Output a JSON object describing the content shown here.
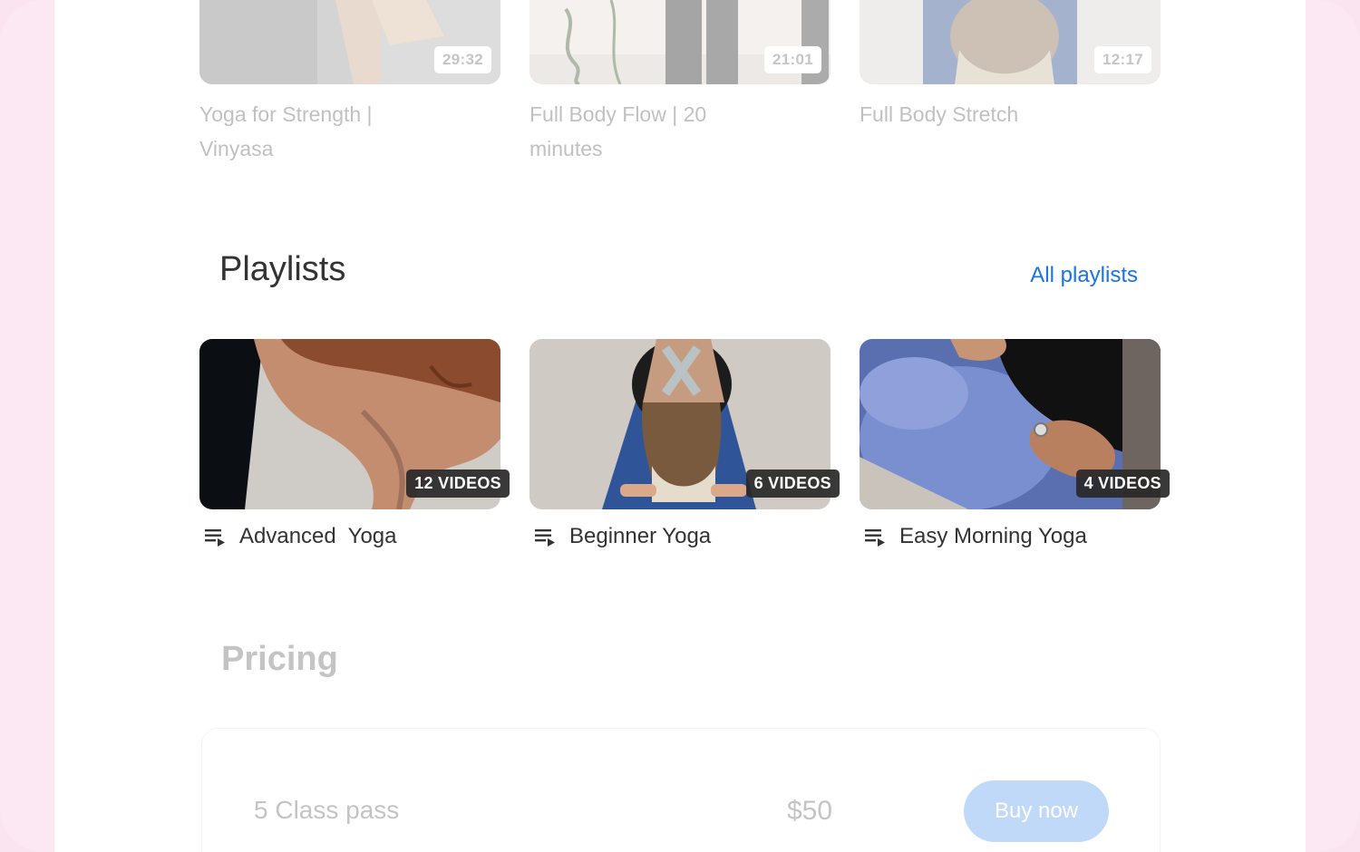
{
  "videos": [
    {
      "title": "Yoga for Strength | Vinyasa",
      "duration": "29:32"
    },
    {
      "title": "Full Body Flow | 20 minutes",
      "duration": "21:01"
    },
    {
      "title": "Full Body Stretch",
      "duration": "12:17"
    }
  ],
  "playlists_section": {
    "title": "Playlists",
    "all_link": "All playlists",
    "items": [
      {
        "title": "Advanced  Yoga",
        "count": "12 VIDEOS"
      },
      {
        "title": "Beginner Yoga",
        "count": "6 VIDEOS"
      },
      {
        "title": "Easy Morning Yoga",
        "count": "4 VIDEOS"
      }
    ]
  },
  "pricing": {
    "title": "Pricing",
    "plans": [
      {
        "name": "5 Class pass",
        "price": "$50",
        "button": "Buy now"
      }
    ]
  },
  "colors": {
    "link": "#1a73e8",
    "button": "#5b9cf0",
    "frame": "#fce8f3"
  }
}
